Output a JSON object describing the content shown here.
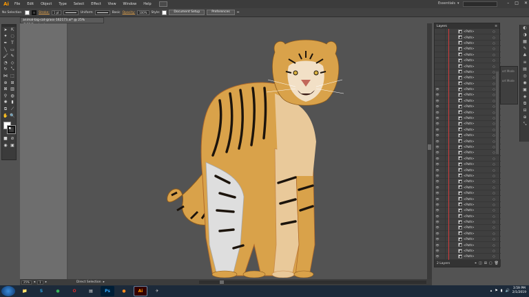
{
  "app": {
    "logo": "Ai",
    "menu": [
      "File",
      "Edit",
      "Object",
      "Type",
      "Select",
      "Effect",
      "View",
      "Window",
      "Help"
    ],
    "workspace": "Essentials",
    "window_controls": [
      "–",
      "□",
      "✕"
    ]
  },
  "control_bar": {
    "selection": "No Selection",
    "stroke_label": "Stroke:",
    "stroke_weight": "1 pt",
    "stroke_profile": "Uniform",
    "brush": "Basic",
    "opacity_label": "Opacity:",
    "opacity_value": "100%",
    "style_label": "Style:",
    "document_setup": "Document Setup",
    "preferences": "Preferences"
  },
  "document": {
    "tab_title": "animal-big-cat-grass-162173.ai* @ 25% (RGB/Preview)",
    "close": "×"
  },
  "status_bar": {
    "zoom": "25%",
    "artboard": "1",
    "tool_status": "Direct Selection"
  },
  "layers_panel": {
    "title": "Layers",
    "menu_icon": "≡",
    "path_label": "<Path>",
    "row_count": 40,
    "footer_label": "2 Layers"
  },
  "dock_mid": [
    "ort Mode",
    "ort Mode"
  ],
  "taskbar": {
    "apps": [
      {
        "name": "explorer",
        "glyph": "📁",
        "color": "#e8b84a"
      },
      {
        "name": "skype",
        "glyph": "S",
        "color": "#2aa3e0"
      },
      {
        "name": "chrome",
        "glyph": "●",
        "color": "#3bb55a"
      },
      {
        "name": "opera",
        "glyph": "O",
        "color": "#d12b2b"
      },
      {
        "name": "notepad",
        "glyph": "▤",
        "color": "#e0e0e0"
      },
      {
        "name": "photoshop",
        "glyph": "Ps",
        "color": "#31a8ff"
      },
      {
        "name": "firefox",
        "glyph": "●",
        "color": "#ff8a1c"
      },
      {
        "name": "illustrator",
        "glyph": "Ai",
        "color": "#ff9a00"
      },
      {
        "name": "other",
        "glyph": "✈",
        "color": "#c0c0c0"
      }
    ],
    "time": "3:59 PM",
    "date": "2/1/2019"
  },
  "colors": {
    "tiger_orange": "#d9a24a",
    "tiger_light": "#e9c99a",
    "tiger_stripe": "#1c140c",
    "tiger_white": "#dedede",
    "red_layer": "#d23a3a"
  }
}
